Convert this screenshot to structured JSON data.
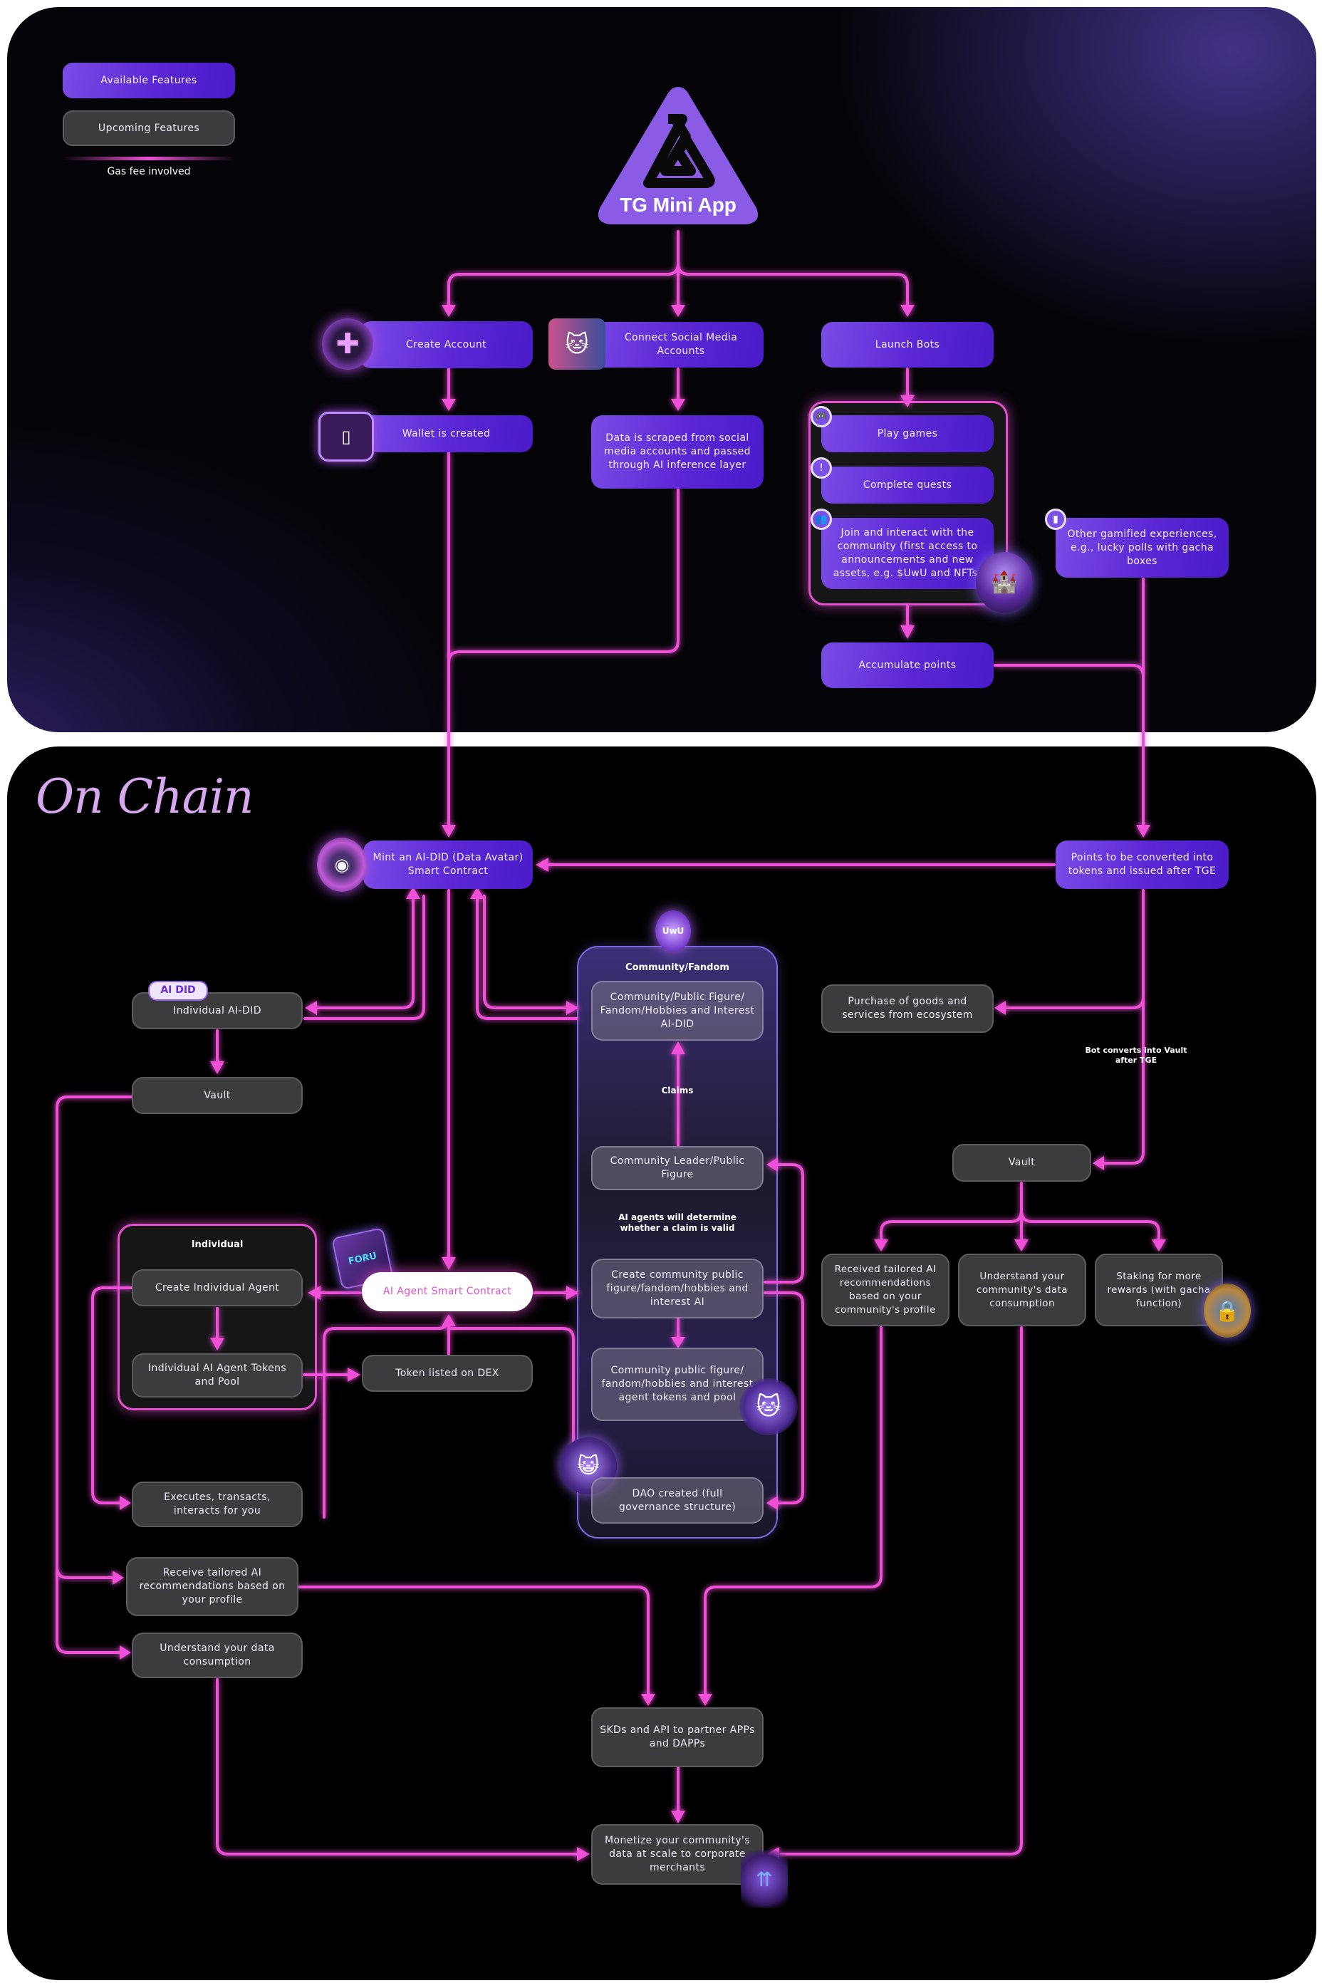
{
  "legend": {
    "available": "Available Features",
    "upcoming": "Upcoming Features",
    "gas": "Gas fee involved"
  },
  "app": {
    "title": "TG Mini App"
  },
  "top": {
    "create_account": "Create Account",
    "connect_social": "Connect Social Media Accounts",
    "launch_bots": "Launch Bots",
    "wallet_created": "Wallet is created",
    "data_scraped": "Data is scraped from social media accounts and passed through AI inference layer",
    "play_games": "Play games",
    "complete_quests": "Complete quests",
    "join_community": "Join and interact with the community (first access to announcements and new assets, e.g. $UwU and NFTs)",
    "other_gamified": "Other gamified experiences, e.g., lucky polls with gacha boxes",
    "accumulate_points": "Accumulate points"
  },
  "onchain": {
    "title": "On Chain",
    "mint": "Mint an AI-DID (Data Avatar) Smart Contract",
    "points_converted": "Points to be converted into tokens and issued after TGE",
    "individual_ai_did": "Individual AI-DID",
    "ai_did_badge": "AI DID",
    "vault_left": "Vault",
    "community_label": "Community/Fandom",
    "community_ai_did": "Community/Public Figure/ Fandom/Hobbies and Interest AI-DID",
    "claims": "Claims",
    "community_leader": "Community Leader/Public Figure",
    "ai_agents_note": "AI agents will determine whether a claim is valid",
    "create_community_ai": "Create community public figure/fandom/hobbies and interest AI",
    "community_tokens": "Community public figure/ fandom/hobbies and interest agent tokens and pool",
    "dao_created": "DAO created (full governance structure)",
    "purchase": "Purchase of goods and services from ecosystem",
    "bot_converts": "Bot converts into Vault after TGE",
    "vault_right": "Vault",
    "received_tailored": "Received tailored AI recommendations based on your community's profile",
    "understand_community": "Understand your community's data consumption",
    "staking": "Staking for more rewards (with gacha function)",
    "individual_label": "Individual",
    "create_individual_agent": "Create Individual Agent",
    "individual_tokens": "Individual AI Agent Tokens and Pool",
    "ai_agent_contract": "AI Agent Smart Contract",
    "foru_badge": "FORU",
    "token_dex": "Token listed on DEX",
    "executes": "Executes, transacts, interacts for you",
    "receive_tailored": "Receive tailored AI recommendations based on your profile",
    "understand_data": "Understand your data consumption",
    "sdks": "SKDs and API to partner APPs and DAPPs",
    "monetize": "Monetize your community's data at scale to corporate merchants"
  },
  "colors": {
    "available": "#5a26d4",
    "upcoming": "#3c3c3f",
    "wire": "#f04fd8",
    "logo": "#8a5ce6",
    "contract_text": "#e64fd0"
  }
}
